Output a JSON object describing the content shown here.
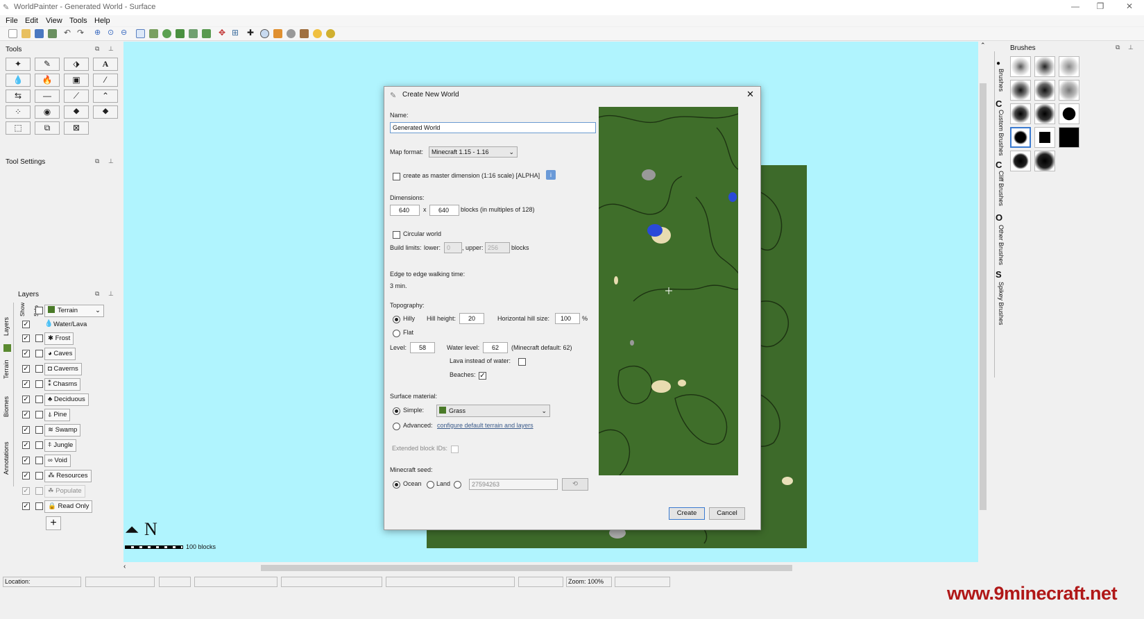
{
  "window": {
    "title": "WorldPainter - Generated World - Surface"
  },
  "menu": [
    "File",
    "Edit",
    "View",
    "Tools",
    "Help"
  ],
  "panels": {
    "tools": "Tools",
    "tool_settings": "Tool Settings",
    "layers": "Layers",
    "brushes": "Brushes"
  },
  "layers_header": {
    "show": "Show",
    "solo": "Solo"
  },
  "layers": [
    {
      "label": "Terrain",
      "show": false
    },
    {
      "label": "Water/Lava",
      "show": true
    },
    {
      "label": "Frost",
      "show": true
    },
    {
      "label": "Caves",
      "show": true
    },
    {
      "label": "Caverns",
      "show": true
    },
    {
      "label": "Chasms",
      "show": true
    },
    {
      "label": "Deciduous",
      "show": true
    },
    {
      "label": "Pine",
      "show": true
    },
    {
      "label": "Swamp",
      "show": true
    },
    {
      "label": "Jungle",
      "show": true
    },
    {
      "label": "Void",
      "show": true
    },
    {
      "label": "Resources",
      "show": true
    },
    {
      "label": "Populate",
      "show": true
    },
    {
      "label": "Read Only",
      "show": true
    }
  ],
  "left_tabs": [
    "Layers",
    "Terrain",
    "Biomes",
    "Annotations"
  ],
  "right_tabs": [
    "Brushes",
    "Custom Brushes",
    "Cliff Brushes",
    "Other Brushes",
    "Spikey Brushes"
  ],
  "right_tab_letters": [
    "C",
    "C",
    "O",
    "S"
  ],
  "compass": {
    "letter": "N",
    "scale_label": "100 blocks"
  },
  "status": {
    "location": "Location:",
    "zoom": "Zoom: 100%"
  },
  "watermark": "www.9minecraft.net",
  "dialog": {
    "title": "Create New World",
    "name_label": "Name:",
    "name_value": "Generated World",
    "map_format_label": "Map format:",
    "map_format_value": "Minecraft 1.15 - 1.16",
    "master_dim_label": "create as master dimension (1:16 scale) [ALPHA]",
    "dimensions_label": "Dimensions:",
    "width": "640",
    "x": "x",
    "height": "640",
    "blocks_note": "blocks (in multiples of 128)",
    "circular_label": "Circular world",
    "build_limits_label": "Build limits:",
    "lower_label": "lower:",
    "lower_value": "0",
    "upper_label": ", upper:",
    "upper_value": "256",
    "blocks": "blocks",
    "edge_walk_label": "Edge to edge walking time:",
    "edge_walk_value": "3 min.",
    "topography_label": "Topography:",
    "hilly_label": "Hilly",
    "hill_height_label": "Hill height:",
    "hill_height_value": "20",
    "horiz_hill_label": "Horizontal hill size:",
    "horiz_hill_value": "100",
    "percent": "%",
    "flat_label": "Flat",
    "level_label": "Level:",
    "level_value": "58",
    "water_level_label": "Water level:",
    "water_level_value": "62",
    "mc_default_label": "(Minecraft default: 62)",
    "lava_label": "Lava instead of water:",
    "beaches_label": "Beaches:",
    "surface_label": "Surface material:",
    "simple_label": "Simple:",
    "simple_value": "Grass",
    "advanced_label": "Advanced:",
    "advanced_link": "configure default terrain and layers",
    "ext_block_label": "Extended block IDs:",
    "seed_label": "Minecraft seed:",
    "ocean_label": "Ocean",
    "land_label": "Land",
    "seed_value": "27594263",
    "create_label": "Create",
    "cancel_label": "Cancel"
  }
}
